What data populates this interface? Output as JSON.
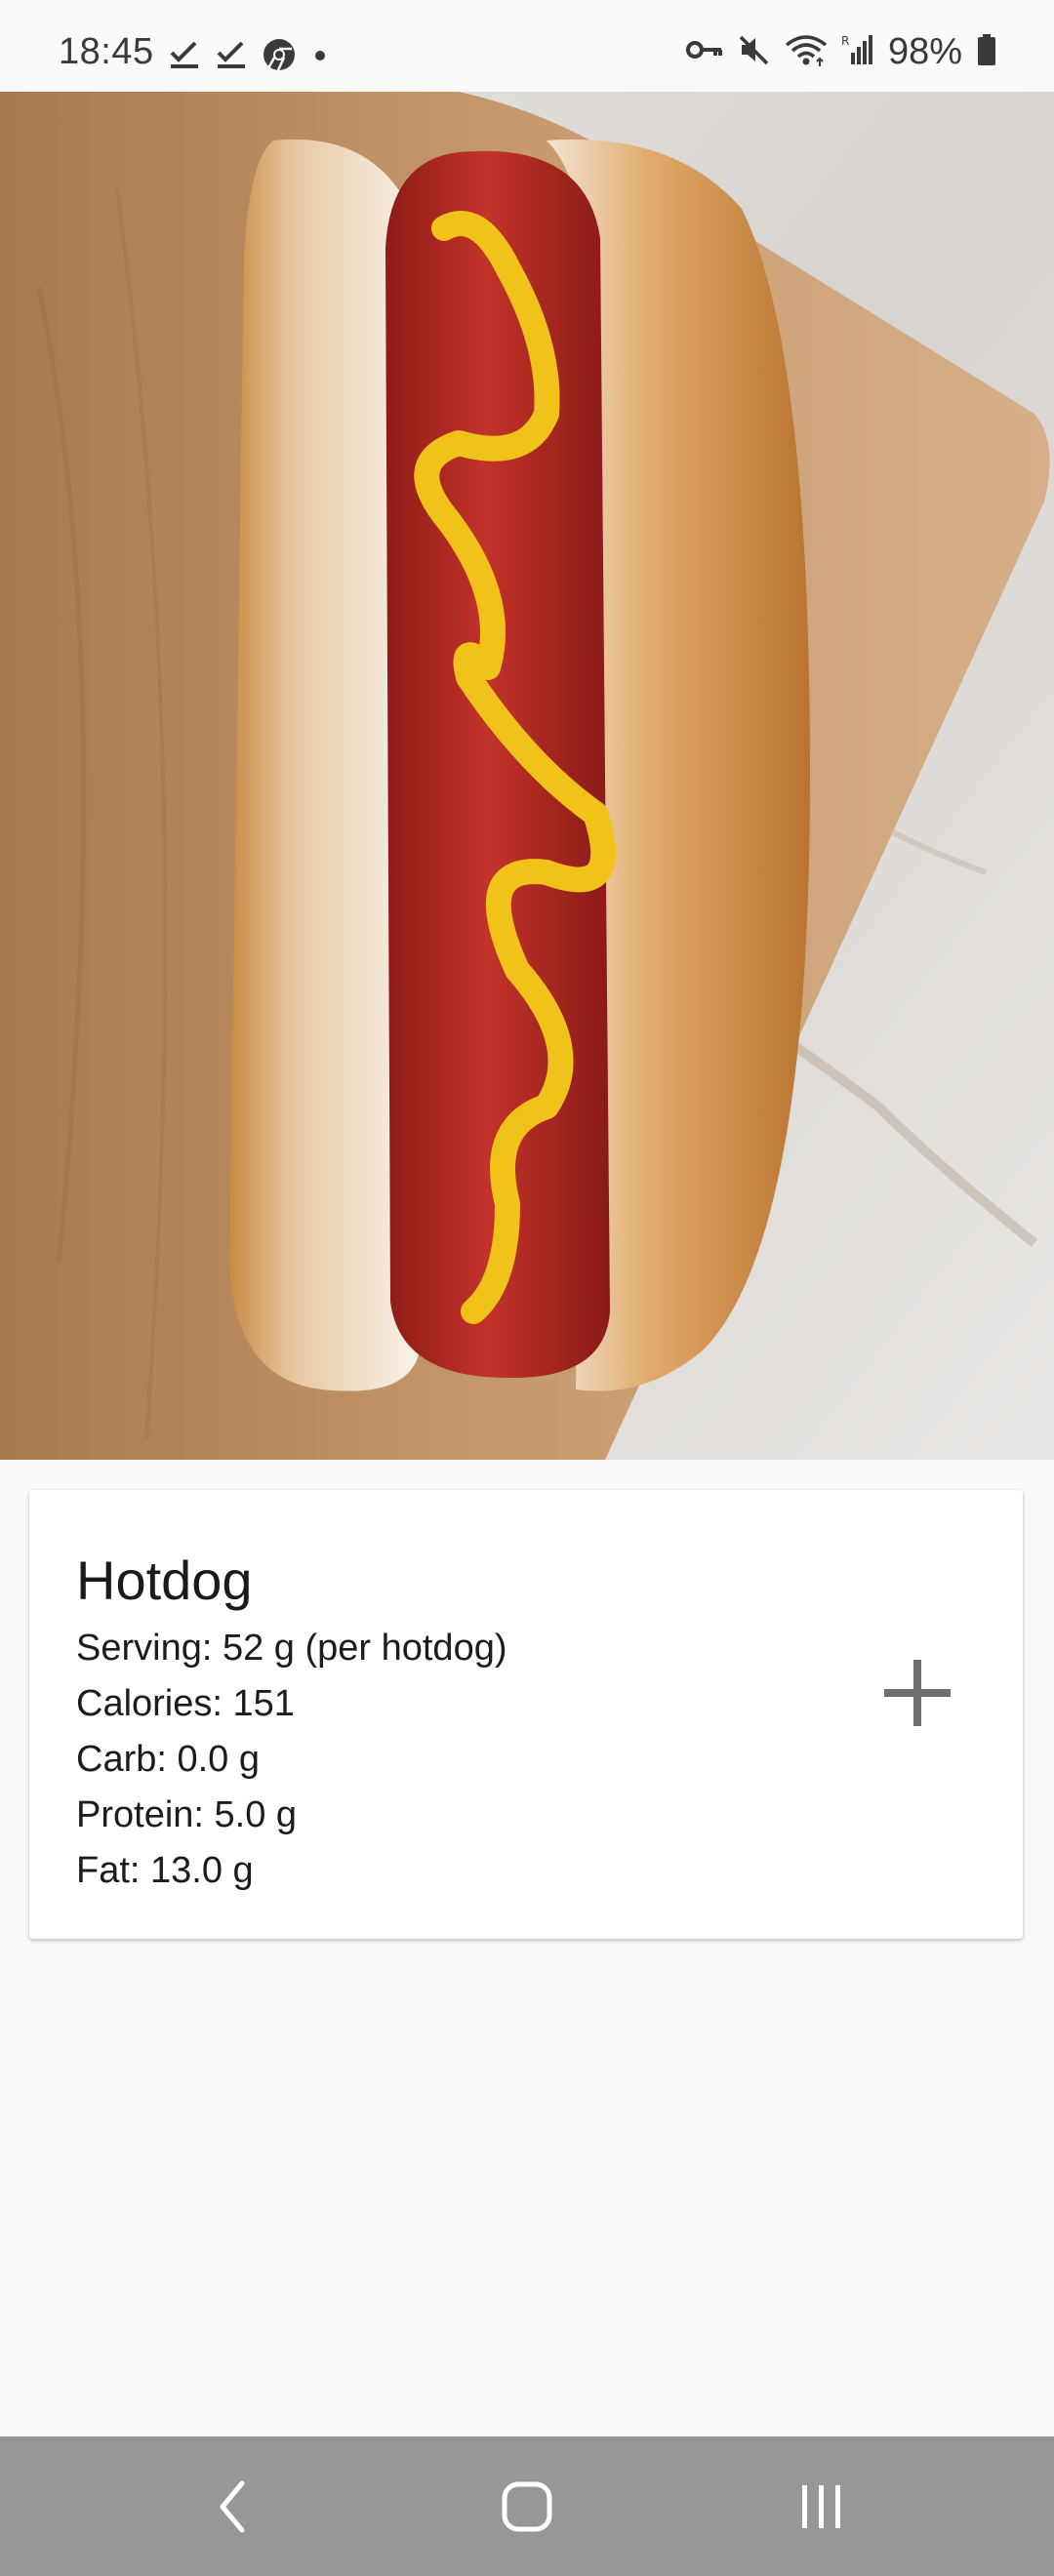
{
  "status_bar": {
    "time": "18:45",
    "battery": "98%",
    "left_icons": [
      "check-download-icon",
      "check-download-icon",
      "chrome-icon",
      "dot-icon"
    ],
    "right_icons": [
      "key-icon",
      "mute-icon",
      "wifi-icon",
      "signal-icon",
      "battery-icon"
    ]
  },
  "hero": {
    "image": "hotdog-photo"
  },
  "food": {
    "title": "Hotdog",
    "serving": "Serving: 52 g (per hotdog)",
    "calories": "Calories: 151",
    "carb": "Carb: 0.0 g",
    "protein": "Protein: 5.0 g",
    "fat": "Fat: 13.0 g",
    "add_icon": "plus-icon"
  },
  "nav_bar": {
    "buttons": [
      "back-icon",
      "home-icon",
      "recents-icon"
    ]
  },
  "colors": {
    "background": "#fafafa",
    "card": "#ffffff",
    "nav_bar": "#979797",
    "text": "#1c1c1c",
    "icon_gray": "#6e6e6e"
  }
}
